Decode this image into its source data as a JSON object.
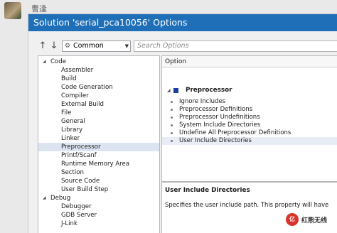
{
  "chat": {
    "sender": "曹逢"
  },
  "window": {
    "title": "Solution 'serial_pca10056' Options"
  },
  "toolbar": {
    "back_icon": "arrow-up-icon",
    "forward_icon": "arrow-down-icon",
    "configuration": "Common",
    "search_placeholder": "Search Options"
  },
  "tree": {
    "items": [
      {
        "label": "Code",
        "level": 0,
        "expanded": true
      },
      {
        "label": "Assembler",
        "level": 1
      },
      {
        "label": "Build",
        "level": 1
      },
      {
        "label": "Code Generation",
        "level": 1
      },
      {
        "label": "Compiler",
        "level": 1
      },
      {
        "label": "External Build",
        "level": 1
      },
      {
        "label": "File",
        "level": 1
      },
      {
        "label": "General",
        "level": 1
      },
      {
        "label": "Library",
        "level": 1
      },
      {
        "label": "Linker",
        "level": 1
      },
      {
        "label": "Preprocessor",
        "level": 1,
        "selected": true
      },
      {
        "label": "Printf/Scanf",
        "level": 1
      },
      {
        "label": "Runtime Memory Area",
        "level": 1
      },
      {
        "label": "Section",
        "level": 1
      },
      {
        "label": "Source Code",
        "level": 1
      },
      {
        "label": "User Build Step",
        "level": 1
      },
      {
        "label": "Debug",
        "level": 0,
        "expanded": true
      },
      {
        "label": "Debugger",
        "level": 1
      },
      {
        "label": "GDB Server",
        "level": 1
      },
      {
        "label": "J-Link",
        "level": 1
      }
    ]
  },
  "properties": {
    "column_header": "Option",
    "section": "Preprocessor",
    "items": [
      {
        "label": "Ignore Includes"
      },
      {
        "label": "Preprocessor Definitions"
      },
      {
        "label": "Preprocessor Undefinitions"
      },
      {
        "label": "System Include Directories"
      },
      {
        "label": "Undefine All Preprocessor Definitions"
      },
      {
        "label": "User Include Directories",
        "selected": true
      }
    ]
  },
  "description": {
    "title": "User Include Directories",
    "text": "Specifies the user include path. This property will have"
  },
  "watermark": {
    "logo": "亿",
    "text": "红熊无线"
  },
  "colors": {
    "titlebar": "#1f6fb8",
    "selection": "#dbe4f0",
    "section_marker": "#1b3fa0"
  }
}
